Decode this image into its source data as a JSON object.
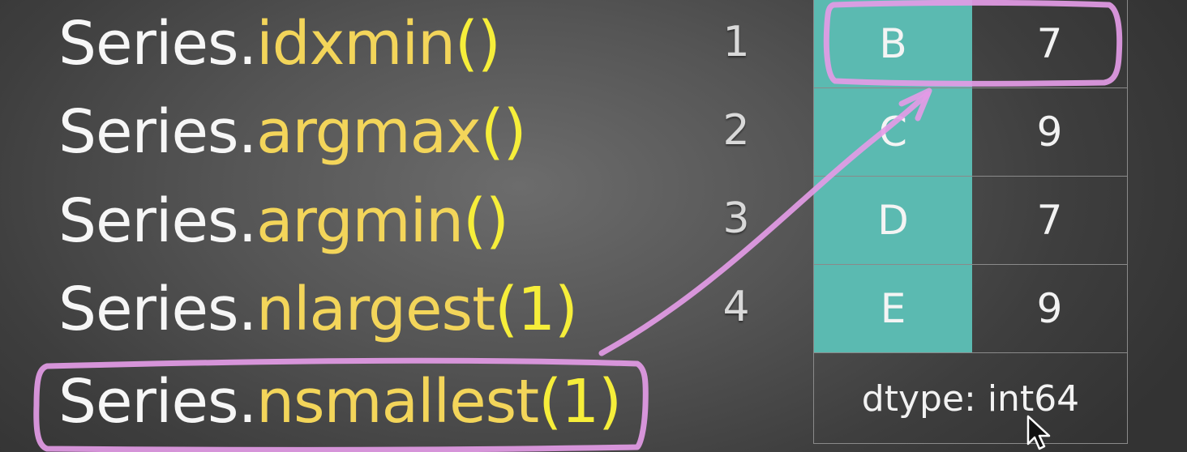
{
  "methods": [
    {
      "object": "Series.",
      "name": "idxmin",
      "args": "()"
    },
    {
      "object": "Series.",
      "name": "argmax",
      "args": "()"
    },
    {
      "object": "Series.",
      "name": "argmin",
      "args": "()"
    },
    {
      "object": "Series.",
      "name": "nlargest",
      "args": "(1)"
    },
    {
      "object": "Series.",
      "name": "nsmallest",
      "args": "(1)"
    }
  ],
  "series": {
    "index": [
      "1",
      "2",
      "3",
      "4"
    ],
    "rows": [
      {
        "label": "B",
        "value": "7"
      },
      {
        "label": "C",
        "value": "9"
      },
      {
        "label": "D",
        "value": "7"
      },
      {
        "label": "E",
        "value": "9"
      }
    ],
    "dtype": "dtype: int64"
  },
  "colors": {
    "annotation": "#e39be6",
    "method_name": "#f3d55a",
    "paren": "#f6ee3a",
    "label_cell": "#5bbab1"
  }
}
